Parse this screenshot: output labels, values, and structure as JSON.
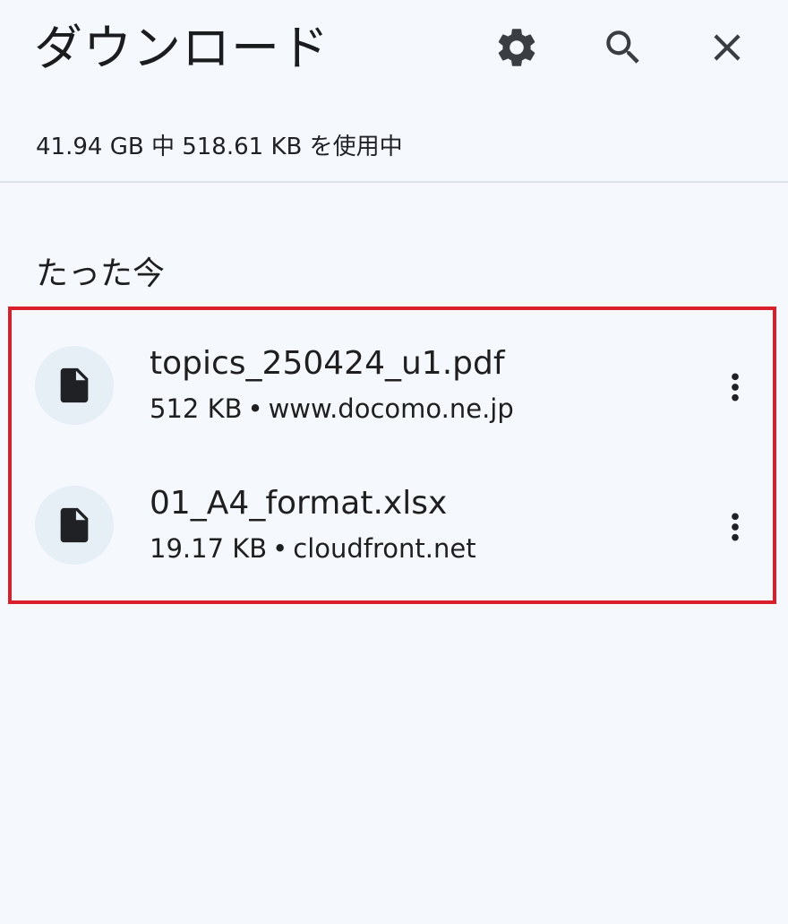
{
  "header": {
    "title": "ダウンロード",
    "icons": [
      "gear-icon",
      "search-icon",
      "close-icon"
    ]
  },
  "storage": {
    "text": "41.94 GB 中 518.61 KB を使用中"
  },
  "section": {
    "label": "たった今"
  },
  "downloads": [
    {
      "name": "topics_250424_u1.pdf",
      "size": "512 KB",
      "separator": "•",
      "source": "www.docomo.ne.jp",
      "icon": "file-icon",
      "menu_icon": "more-vert-icon"
    },
    {
      "name": "01_A4_format.xlsx",
      "size": "19.17 KB",
      "separator": "•",
      "source": "cloudfront.net",
      "icon": "file-icon",
      "menu_icon": "more-vert-icon"
    }
  ],
  "colors": {
    "background": "#f5f9fe",
    "highlight_border": "#d81f2a",
    "icon_dark": "#1f2125",
    "avatar_bg": "#e6eef6",
    "divider": "#dbe2ea"
  }
}
